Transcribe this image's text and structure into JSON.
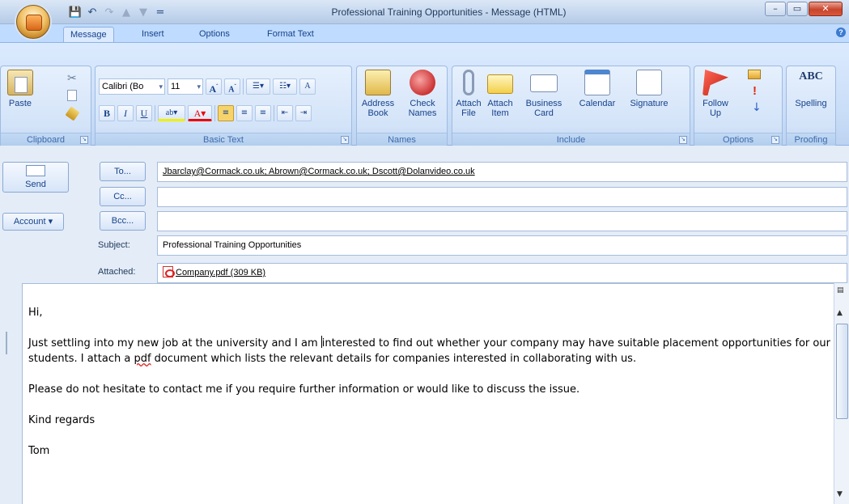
{
  "window": {
    "title": "Professional Training Opportunities - Message (HTML)"
  },
  "qat": {
    "save_icon": "💾",
    "undo_icon": "↶",
    "redo_icon": "↷",
    "up_icon": "▲",
    "down_icon": "▼",
    "customize_icon": "="
  },
  "winbtns": {
    "min": "–",
    "max": "▭",
    "close": "✕"
  },
  "tabs": [
    "Message",
    "Insert",
    "Options",
    "Format Text"
  ],
  "ribbon": {
    "clipboard": {
      "label": "Clipboard",
      "paste": "Paste"
    },
    "basic_text": {
      "label": "Basic Text",
      "font": "Calibri (Bo",
      "size": "11"
    },
    "names": {
      "label": "Names",
      "address_book": "Address Book",
      "check_names": "Check Names"
    },
    "include": {
      "label": "Include",
      "attach_file": "Attach File",
      "attach_item": "Attach Item",
      "business_card": "Business Card",
      "calendar": "Calendar",
      "signature": "Signature"
    },
    "options": {
      "label": "Options",
      "follow_up": "Follow Up"
    },
    "proofing": {
      "label": "Proofing",
      "spelling": "Spelling",
      "abc": "ABC"
    }
  },
  "compose": {
    "send": "Send",
    "account": "Account",
    "to_btn": "To...",
    "cc_btn": "Cc...",
    "bcc_btn": "Bcc...",
    "to_value": "Jbarclay@Cormack.co.uk; Abrown@Cormack.co.uk; Dscott@Dolanvideo.co.uk",
    "cc_value": "",
    "bcc_value": "",
    "subject_label": "Subject:",
    "subject_value": "Professional Training Opportunities",
    "attached_label": "Attached:",
    "attachment": "Company.pdf (309 KB)"
  },
  "body": {
    "greeting": "Hi,",
    "para1_a": "Just settling into my new job at the university and I am ",
    "para1_b": "interested to find out whether your company may have suitable placement opportunities for our students. I attach a ",
    "para1_pdf": "pdf",
    "para1_c": " document which lists the relevant details for companies interested in collaborating with us.",
    "para2": "Please do not hesitate to contact me if you require further information or would like to discuss the issue.",
    "closing": "Kind regards",
    "signature": "Tom"
  },
  "colors": {
    "ribbon_bg": "#c9ddf7",
    "tab_text": "#15428b",
    "link_red": "#d22"
  }
}
